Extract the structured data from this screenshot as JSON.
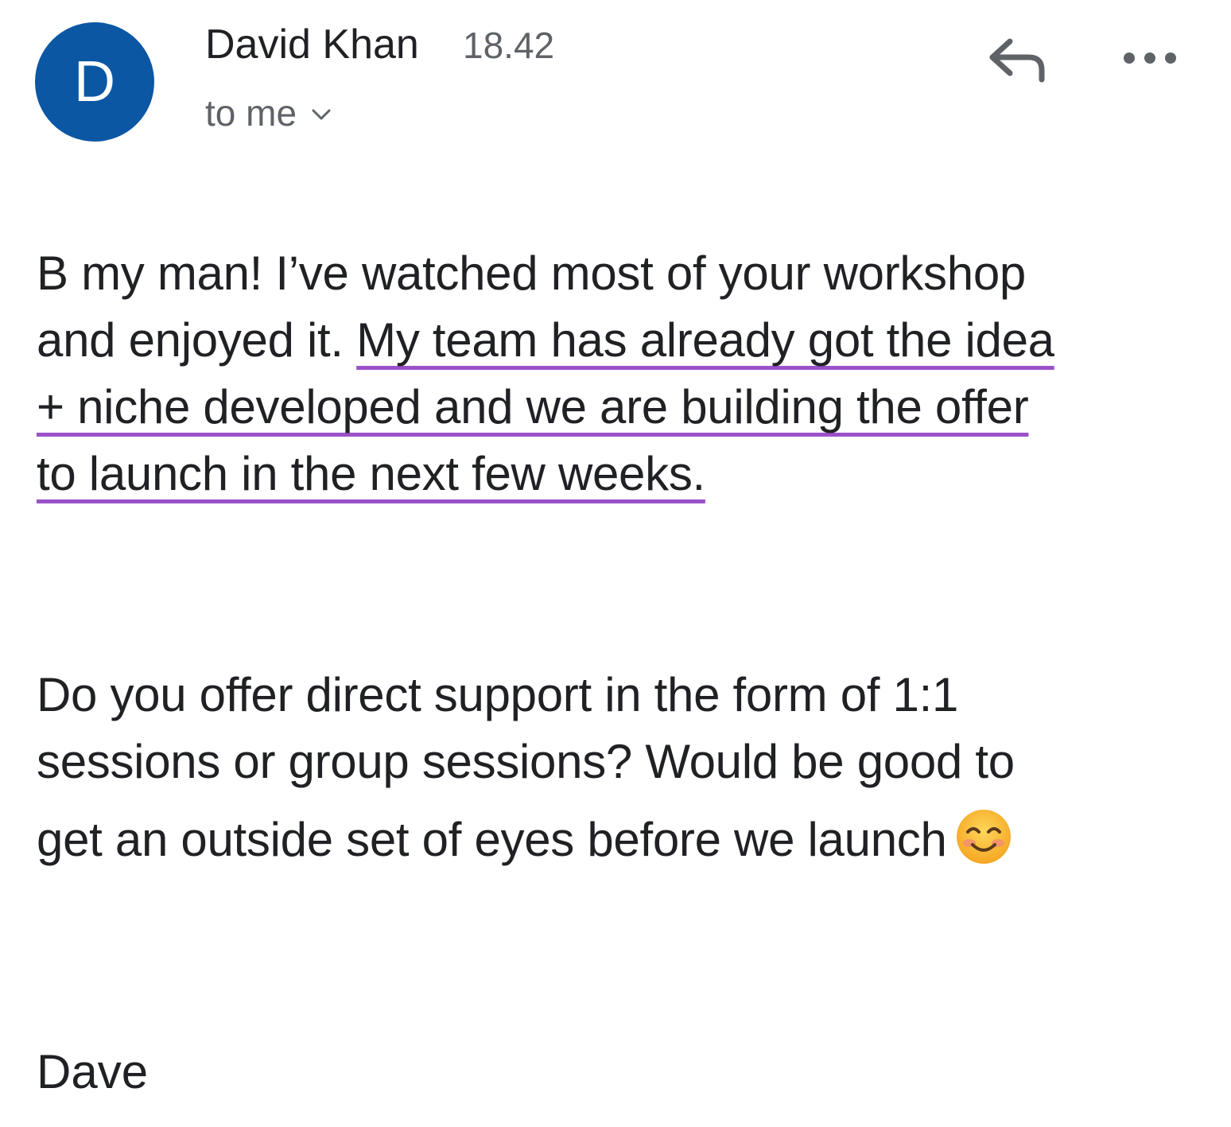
{
  "header": {
    "avatar_initial": "D",
    "avatar_color": "#0b57a4",
    "sender_name": "David Khan",
    "time": "18.42",
    "recipient_label": "to me",
    "recipient_icon": "chevron-down-icon",
    "reply_icon": "reply-icon",
    "more_icon": "more-horizontal-icon"
  },
  "body": {
    "p1_line1": "B my man!  I’ve watched most of your workshop",
    "p1_line2_plain": "and enjoyed it.  ",
    "p1_line2_highlight": "My team has already got the idea",
    "p1_line3_highlight": "+ niche developed and we are building the offer",
    "p1_line4_highlight": "to launch in the next few weeks.",
    "highlight_color": "#9b51c9",
    "p2_line1": "Do you offer direct support in the form of 1:1",
    "p2_line2": "sessions or group sessions?  Would be good to",
    "p2_line3": "get an outside set of eyes before we launch",
    "emoji_icon": "smiling-face-emoji-icon",
    "signature": "Dave"
  }
}
